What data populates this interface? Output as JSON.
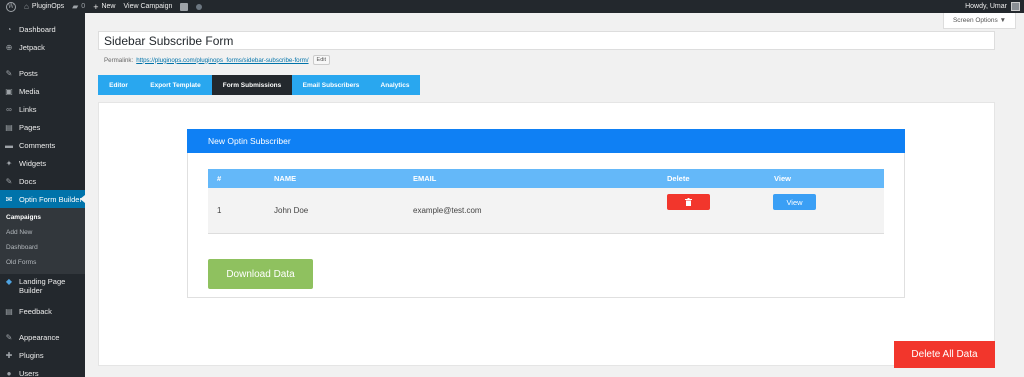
{
  "admin_bar": {
    "wp_logo": "W",
    "site_name": "PluginOps",
    "comments_count": "0",
    "new_label": "New",
    "view_campaign_label": "View Campaign",
    "greeting": "Howdy, Umar",
    "icons": {
      "site": "home-icon",
      "comments": "comment-bubble-icon",
      "new": "plus-icon",
      "seo": "yoast-icon",
      "status": "status-dot-icon"
    }
  },
  "sidebar": {
    "items": [
      {
        "label": "Dashboard",
        "icon": "dashboard-icon",
        "glyph": "◔"
      },
      {
        "label": "Jetpack",
        "icon": "jetpack-icon",
        "glyph": "⊕"
      },
      {
        "label": "Posts",
        "icon": "pin-icon",
        "glyph": "✎"
      },
      {
        "label": "Media",
        "icon": "media-icon",
        "glyph": "▣"
      },
      {
        "label": "Links",
        "icon": "link-icon",
        "glyph": "∞"
      },
      {
        "label": "Pages",
        "icon": "page-icon",
        "glyph": "▤"
      },
      {
        "label": "Comments",
        "icon": "comments-icon",
        "glyph": "▬"
      },
      {
        "label": "Widgets",
        "icon": "widgets-icon",
        "glyph": "✦"
      },
      {
        "label": "Docs",
        "icon": "docs-icon",
        "glyph": "✎"
      },
      {
        "label": "Optin Form Builder",
        "icon": "envelope-icon",
        "glyph": "✉"
      }
    ],
    "submenu": [
      "Campaigns",
      "Add New",
      "Dashboard",
      "Old Forms"
    ],
    "items_after": [
      {
        "label": "Landing Page Builder",
        "icon": "landing-page-icon",
        "glyph": "◆"
      },
      {
        "label": "Feedback",
        "icon": "feedback-icon",
        "glyph": "▤"
      },
      {
        "label": "Appearance",
        "icon": "paintbrush-icon",
        "glyph": "✎"
      },
      {
        "label": "Plugins",
        "icon": "plugins-icon",
        "glyph": "✚"
      },
      {
        "label": "Users",
        "icon": "users-icon",
        "glyph": "●"
      }
    ]
  },
  "screen_options": {
    "label": "Screen Options ▼"
  },
  "post": {
    "title": "Sidebar Subscribe Form",
    "permalink_label": "Permalink:",
    "permalink_url": "https://pluginops.com/pluginops_forms/sidebar-subscribe-form/",
    "edit_label": "Edit"
  },
  "tabs": [
    "Editor",
    "Export Template",
    "Form Submissions",
    "Email Subscribers",
    "Analytics"
  ],
  "active_tab": "Form Submissions",
  "subscribers": {
    "header": "New Optin Subscriber",
    "columns": [
      "#",
      "NAME",
      "EMAIL",
      "Delete",
      "View"
    ],
    "rows": [
      {
        "num": "1",
        "name": "John Doe",
        "email": "example@test.com",
        "delete_icon": "trash-icon",
        "view_label": "View"
      }
    ]
  },
  "actions": {
    "download_label": "Download Data",
    "delete_all_label": "Delete All Data"
  },
  "colors": {
    "admin_dark": "#23282d",
    "active_blue": "#0073aa",
    "tab_blue": "#29a7ef",
    "header_blue": "#0f80f4",
    "table_header": "#64b8f9",
    "delete_red": "#f2362c",
    "view_blue": "#3a9ff5",
    "download_green": "#8fc15f"
  }
}
